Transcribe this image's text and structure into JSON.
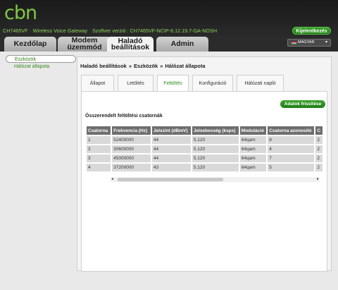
{
  "header": {
    "logo_text": "cbn",
    "model": "CH7465VF",
    "product": "Wireless Voice Gateway",
    "software": "Szoftver verzió : CH7465VF-NCIP-6.12.19.7-GA-NOSH",
    "logout_label": "Kijelentkezés"
  },
  "nav": {
    "tabs": [
      {
        "label": "Kezdőlap"
      },
      {
        "label": "Modem üzemmód"
      },
      {
        "label": "Haladó beállítások"
      },
      {
        "label": "Admin"
      }
    ],
    "language": "MAGYAR"
  },
  "sidebar": {
    "items": [
      {
        "label": "Eszközök"
      },
      {
        "label": "Hálózat állapota"
      }
    ]
  },
  "breadcrumb": [
    "Haladó beállítások",
    "Eszközök",
    "Hálózat állapota"
  ],
  "breadcrumb_sep": "»",
  "subtabs": [
    {
      "label": "Állapot"
    },
    {
      "label": "Letöltés"
    },
    {
      "label": "Feltöltés"
    },
    {
      "label": "Konfiguráció"
    },
    {
      "label": "Hálózati napló"
    }
  ],
  "refresh_label": "Adatok frissítése",
  "section_title": "Összerendelt feltöltési csatornák",
  "table": {
    "headers": [
      "Csatorna",
      "Frekvencia (Hz)",
      "Jelszint (dBmV)",
      "Jelsebesség (ksps)",
      "Moduláció",
      "Csatorna azonosító",
      "C"
    ],
    "rows": [
      [
        "1",
        "52400000",
        "44",
        "5.120",
        "64qam",
        "8",
        "2"
      ],
      [
        "2",
        "30600000",
        "44",
        "5.120",
        "64qam",
        "4",
        "2"
      ],
      [
        "3",
        "45000000",
        "44",
        "5.120",
        "64qam",
        "7",
        "2"
      ],
      [
        "4",
        "37200000",
        "43",
        "5.120",
        "64qam",
        "5",
        "2"
      ]
    ]
  },
  "colors": {
    "accent": "#3ea52f",
    "header_bg": "#1a1a1a",
    "logo": "#7ec843"
  }
}
